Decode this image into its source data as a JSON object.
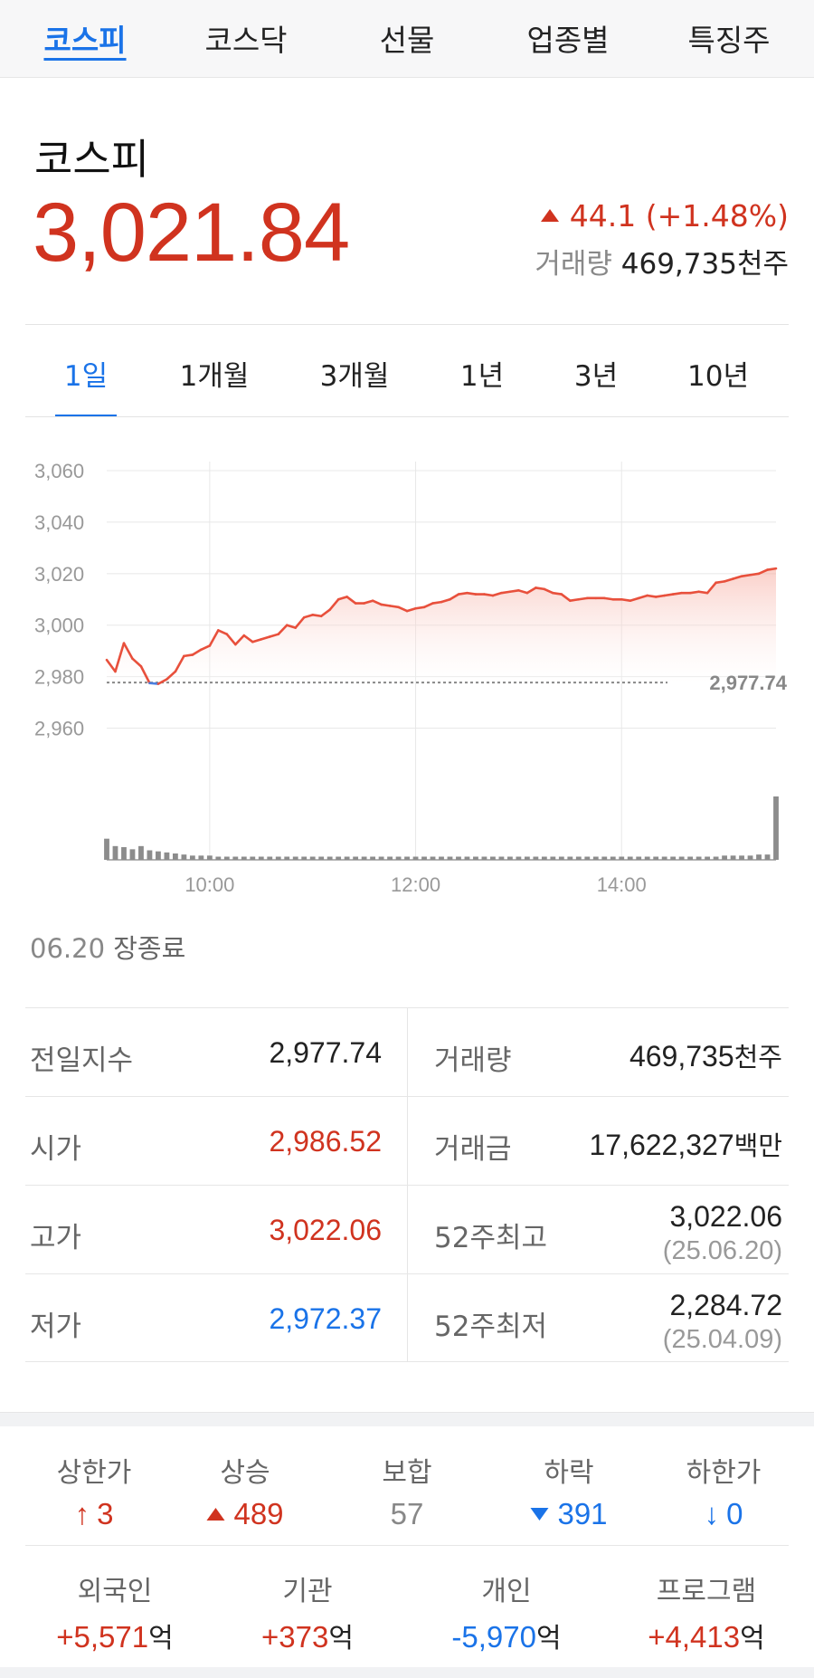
{
  "nav": {
    "tabs": [
      "코스피",
      "코스닥",
      "선물",
      "업종별",
      "특징주"
    ],
    "active_index": 0
  },
  "index": {
    "name": "코스피",
    "value": "3,021.84",
    "change": "44.1 (+1.48%)",
    "direction": "up",
    "volume_label": "거래량",
    "volume_value": "469,735",
    "volume_unit": "천주"
  },
  "period_tabs": {
    "items": [
      "1일",
      "1개월",
      "3개월",
      "1년",
      "3년",
      "10년"
    ],
    "active_index": 0
  },
  "chart_data": {
    "type": "line",
    "y_ticks": [
      "3,060",
      "3,040",
      "3,020",
      "3,000",
      "2,980",
      "2,960"
    ],
    "x_ticks": [
      "10:00",
      "12:00",
      "14:00"
    ],
    "ylim": [
      2950,
      3060
    ],
    "xlim": [
      "09:00",
      "15:30"
    ],
    "reference_line": {
      "value": 2977.74,
      "label": "2,977.74"
    },
    "series": [
      {
        "x": [
          "09:00",
          "09:05",
          "09:10",
          "09:15",
          "09:20",
          "09:25",
          "09:30",
          "09:35",
          "09:40",
          "09:45",
          "09:50",
          "09:55",
          "10:00",
          "10:05",
          "10:10",
          "10:15",
          "10:20",
          "10:25",
          "10:30",
          "10:35",
          "10:40",
          "10:45",
          "10:50",
          "10:55",
          "11:00",
          "11:05",
          "11:10",
          "11:15",
          "11:20",
          "11:25",
          "11:30",
          "11:35",
          "11:40",
          "11:45",
          "11:50",
          "11:55",
          "12:00",
          "12:05",
          "12:10",
          "12:15",
          "12:20",
          "12:25",
          "12:30",
          "12:35",
          "12:40",
          "12:45",
          "12:50",
          "12:55",
          "13:00",
          "13:05",
          "13:10",
          "13:15",
          "13:20",
          "13:25",
          "13:30",
          "13:35",
          "13:40",
          "13:45",
          "13:50",
          "13:55",
          "14:00",
          "14:05",
          "14:10",
          "14:15",
          "14:20",
          "14:25",
          "14:30",
          "14:35",
          "14:40",
          "14:45",
          "14:50",
          "14:55",
          "15:00",
          "15:05",
          "15:10",
          "15:15",
          "15:20",
          "15:25",
          "15:30"
        ],
        "y": [
          2986.5,
          2982,
          2993,
          2987,
          2984,
          2977.5,
          2977.2,
          2979,
          2982,
          2988,
          2988.5,
          2990.5,
          2992,
          2998,
          2996.5,
          2992.5,
          2996,
          2993.5,
          2994.5,
          2995.5,
          2996.5,
          3000,
          2999,
          3003,
          3004,
          3003.5,
          3006,
          3010,
          3011,
          3008.5,
          3008.5,
          3009.5,
          3008,
          3007.5,
          3007,
          3005.5,
          3006.5,
          3007,
          3008.5,
          3009,
          3010,
          3012,
          3012.5,
          3012,
          3012,
          3011.5,
          3012.5,
          3013,
          3013.5,
          3012.5,
          3014.5,
          3014,
          3012.5,
          3012,
          3009.5,
          3010,
          3010.5,
          3010.5,
          3010.5,
          3010,
          3010,
          3009.5,
          3010.5,
          3011.5,
          3011,
          3011.5,
          3012,
          3012.5,
          3012.5,
          3013,
          3012.5,
          3016.5,
          3017,
          3018,
          3019,
          3019.5,
          3020,
          3021.5,
          3022
        ]
      }
    ],
    "volume": [
      20,
      13,
      12,
      10,
      13,
      9,
      8,
      7,
      6,
      5,
      4,
      4,
      4,
      3,
      3,
      3,
      3,
      3,
      3,
      3,
      3,
      3,
      3,
      3,
      3,
      3,
      3,
      3,
      3,
      3,
      3,
      3,
      3,
      3,
      3,
      3,
      3,
      3,
      3,
      3,
      3,
      3,
      3,
      3,
      3,
      3,
      3,
      3,
      3,
      3,
      3,
      3,
      3,
      3,
      3,
      3,
      3,
      3,
      3,
      3,
      3,
      3,
      3,
      3,
      3,
      3,
      3,
      3,
      3,
      3,
      3,
      3,
      4,
      4,
      4,
      4,
      5,
      5,
      60
    ],
    "colors": {
      "up": "#e8503c",
      "down": "#4a7fe0",
      "fill": "#f6b4aa",
      "grid": "#e8e8e8",
      "volume": "#8c8c8c"
    }
  },
  "market_status": {
    "date": "06.20",
    "label": "장종료"
  },
  "stats": [
    {
      "left_label": "전일지수",
      "left_value": "2,977.74",
      "left_dir": "flat",
      "right_label": "거래량",
      "right_value": "469,735",
      "right_unit": "천주"
    },
    {
      "left_label": "시가",
      "left_value": "2,986.52",
      "left_dir": "up",
      "right_label": "거래금",
      "right_value": "17,622,327",
      "right_unit": "백만"
    },
    {
      "left_label": "고가",
      "left_value": "3,022.06",
      "left_dir": "up",
      "right_label": "52주최고",
      "right_value": "3,022.06",
      "right_sub": "(25.06.20)"
    },
    {
      "left_label": "저가",
      "left_value": "2,972.37",
      "left_dir": "down",
      "right_label": "52주최저",
      "right_value": "2,284.72",
      "right_sub": "(25.04.09)"
    }
  ],
  "breadth": {
    "upper_limit": {
      "label": "상한가",
      "value": "3"
    },
    "advance": {
      "label": "상승",
      "value": "489"
    },
    "unchanged": {
      "label": "보합",
      "value": "57"
    },
    "decline": {
      "label": "하락",
      "value": "391"
    },
    "lower_limit": {
      "label": "하한가",
      "value": "0"
    }
  },
  "investors": {
    "unit": "억",
    "foreign": {
      "label": "외국인",
      "value": "+5,571"
    },
    "institution": {
      "label": "기관",
      "value": "+373"
    },
    "individual": {
      "label": "개인",
      "value": "-5,970"
    },
    "program": {
      "label": "프로그램",
      "value": "+4,413"
    }
  }
}
